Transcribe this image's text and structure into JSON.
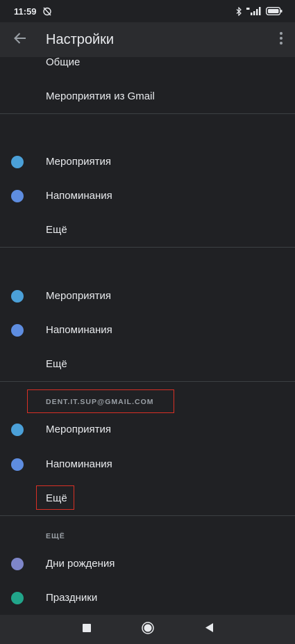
{
  "status_bar": {
    "time": "11:59"
  },
  "app_bar": {
    "title": "Настройки"
  },
  "general": {
    "items": [
      {
        "label": "Общие"
      },
      {
        "label": "Мероприятия из Gmail"
      }
    ]
  },
  "account1": {
    "items": [
      {
        "label": "Мероприятия",
        "color": "#4ba0d8"
      },
      {
        "label": "Напоминания",
        "color": "#5e8de0"
      },
      {
        "label": "Ещё"
      }
    ]
  },
  "account2": {
    "items": [
      {
        "label": "Мероприятия",
        "color": "#4ba0d8"
      },
      {
        "label": "Напоминания",
        "color": "#5e8de0"
      },
      {
        "label": "Ещё"
      }
    ]
  },
  "account3": {
    "header": "DENT.IT.SUP@GMAIL.COM",
    "items": [
      {
        "label": "Мероприятия",
        "color": "#4ba0d8"
      },
      {
        "label": "Напоминания",
        "color": "#5e8de0"
      },
      {
        "label": "Ещё"
      }
    ]
  },
  "more_section": {
    "header": "ЕЩЁ",
    "items": [
      {
        "label": "Дни рождения",
        "color": "#7e86c9"
      },
      {
        "label": "Праздники",
        "color": "#21a58a"
      }
    ]
  },
  "colors": {
    "background": "#202124",
    "app_bar": "#2b2c2f",
    "divider": "#3c4043",
    "highlight": "#d93025"
  }
}
